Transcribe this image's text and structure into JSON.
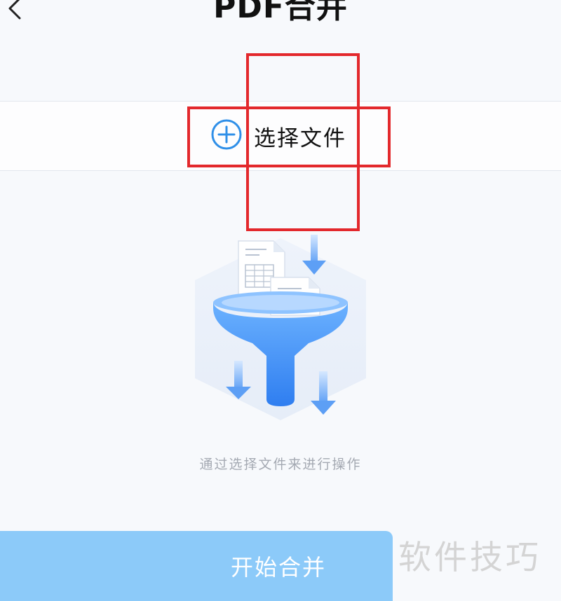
{
  "header": {
    "title": "PDF合并",
    "back_icon": "chevron-left-icon"
  },
  "select_file": {
    "label": "选择文件",
    "icon": "plus-circle-icon"
  },
  "hint": "通过选择文件来进行操作",
  "merge_button": {
    "label": "开始合并"
  },
  "watermark": "软件技巧",
  "colors": {
    "accent": "#2f8fe8",
    "button": "#8ccaf9",
    "highlight": "#e3282c"
  }
}
